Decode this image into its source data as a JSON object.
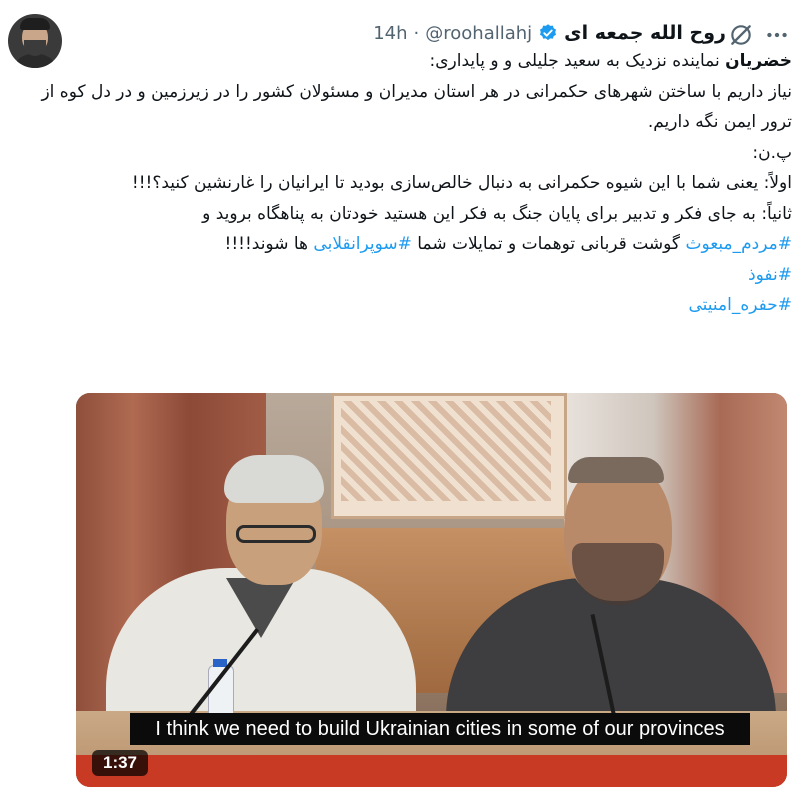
{
  "tweet": {
    "author": {
      "display_name": "روح الله جمعه ای",
      "handle": "@roohallahj",
      "separator": "·",
      "time": "14h"
    },
    "text": {
      "line1_bold": "خضریان",
      "line1_rest": " نماینده نزدیک به سعید جلیلی و و پایداری:",
      "line2": "نیاز داریم با ساختن شهرهای حکمرانی در هر استان مدیران و مسئولان کشور را در زیرزمین و در دل کوه از ترور ایمن نگه داریم.",
      "line3": "پ.ن:",
      "line4": "اولاً: یعنی شما با این شیوه حکمرانی به دنبال خالص‌سازی بودید تا ایرانیان را غارنشین کنید؟!!!",
      "line5": "ثانیاً: به جای فکر و تدبیر برای پایان جنگ به فکر این هستید خودتان به پناهگاه بروید و",
      "hashtag1": "#مردم_مبعوث",
      "line6_mid": " گوشت قربانی توهمات و تمایلات شما ",
      "hashtag2": "#سوپرانقلابی",
      "line6_end": " ها شوند!!!!",
      "hashtag3": "#نفوذ",
      "hashtag4": "#حفره_امنیتی"
    },
    "media": {
      "caption": "I think we need to build Ukrainian cities in some of our provinces",
      "duration": "1:37"
    },
    "icons": {
      "verified": "verified-badge-icon",
      "grok": "grok-icon",
      "more": "more-icon"
    },
    "colors": {
      "link": "#1d9bf0",
      "verified": "#1d9bf0",
      "secondary_text": "#536471"
    }
  }
}
